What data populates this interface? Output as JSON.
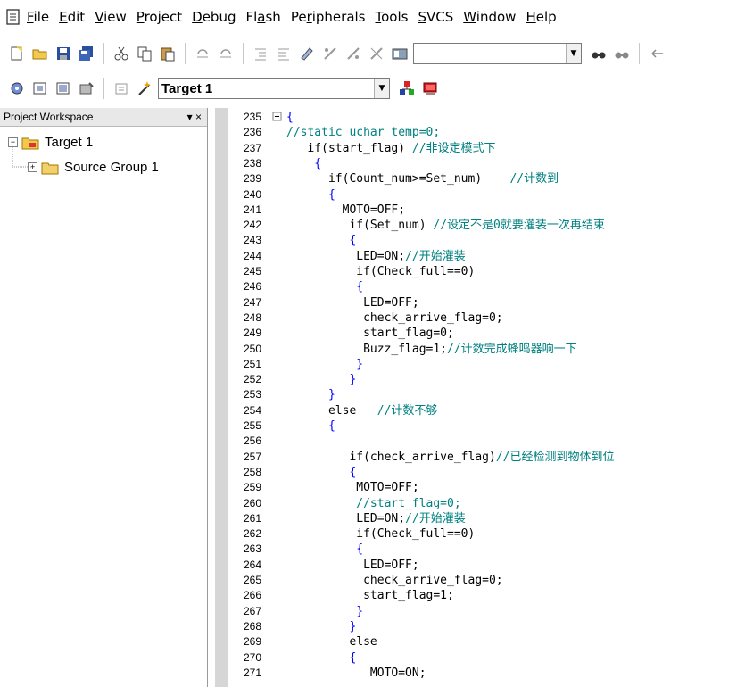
{
  "menu": {
    "items": [
      {
        "u": "F",
        "rest": "ile"
      },
      {
        "u": "E",
        "rest": "dit"
      },
      {
        "u": "V",
        "rest": "iew"
      },
      {
        "u": "P",
        "rest": "roject"
      },
      {
        "u": "D",
        "rest": "ebug"
      },
      {
        "pre": "Fl",
        "u": "a",
        "rest": "sh"
      },
      {
        "pre": "Pe",
        "u": "r",
        "rest": "ipherals"
      },
      {
        "u": "T",
        "rest": "ools"
      },
      {
        "u": "S",
        "rest": "VCS"
      },
      {
        "u": "W",
        "rest": "indow"
      },
      {
        "u": "H",
        "rest": "elp"
      }
    ]
  },
  "toolbar2": {
    "target_combo": "Target 1"
  },
  "workspace": {
    "title": "Project Workspace",
    "controls": "▾ ×",
    "tree": [
      {
        "label": "Target 1",
        "expander": "−"
      },
      {
        "label": "Source Group 1",
        "expander": "+"
      }
    ]
  },
  "editor": {
    "lines": [
      {
        "n": "235",
        "segs": [
          {
            "t": "{",
            "c": "cyan"
          }
        ]
      },
      {
        "n": "236",
        "segs": [
          {
            "t": "//static uchar temp=0;",
            "c": "cmt"
          }
        ]
      },
      {
        "n": "237",
        "segs": [
          {
            "t": "   if(start_flag) ",
            "c": ""
          },
          {
            "t": "//非设定模式下",
            "c": "cmt"
          }
        ]
      },
      {
        "n": "238",
        "segs": [
          {
            "t": "    {",
            "c": "cyan"
          }
        ]
      },
      {
        "n": "239",
        "segs": [
          {
            "t": "      if(Count_num>=Set_num)    ",
            "c": ""
          },
          {
            "t": "//计数到",
            "c": "cmt"
          }
        ]
      },
      {
        "n": "240",
        "segs": [
          {
            "t": "      {",
            "c": "cyan"
          }
        ]
      },
      {
        "n": "241",
        "segs": [
          {
            "t": "        MOTO=OFF;",
            "c": ""
          }
        ]
      },
      {
        "n": "242",
        "segs": [
          {
            "t": "         if(Set_num) ",
            "c": ""
          },
          {
            "t": "//设定不是0就要灌装一次再结束",
            "c": "cmt"
          }
        ]
      },
      {
        "n": "243",
        "segs": [
          {
            "t": "         {",
            "c": "cyan"
          }
        ]
      },
      {
        "n": "244",
        "segs": [
          {
            "t": "          LED=ON;",
            "c": ""
          },
          {
            "t": "//开始灌装",
            "c": "cmt"
          }
        ]
      },
      {
        "n": "245",
        "segs": [
          {
            "t": "          if(Check_full==0)",
            "c": ""
          }
        ]
      },
      {
        "n": "246",
        "segs": [
          {
            "t": "          {",
            "c": "cyan"
          }
        ]
      },
      {
        "n": "247",
        "segs": [
          {
            "t": "           LED=OFF;",
            "c": ""
          }
        ]
      },
      {
        "n": "248",
        "segs": [
          {
            "t": "           check_arrive_flag=0;",
            "c": ""
          }
        ]
      },
      {
        "n": "249",
        "segs": [
          {
            "t": "           start_flag=0;",
            "c": ""
          }
        ]
      },
      {
        "n": "250",
        "segs": [
          {
            "t": "           Buzz_flag=1;",
            "c": ""
          },
          {
            "t": "//计数完成蜂鸣器响一下",
            "c": "cmt"
          }
        ]
      },
      {
        "n": "251",
        "segs": [
          {
            "t": "          }",
            "c": "cyan"
          }
        ]
      },
      {
        "n": "252",
        "segs": [
          {
            "t": "         }",
            "c": "cyan"
          }
        ]
      },
      {
        "n": "253",
        "segs": [
          {
            "t": "      }",
            "c": "cyan"
          }
        ]
      },
      {
        "n": "254",
        "segs": [
          {
            "t": "      else   ",
            "c": ""
          },
          {
            "t": "//计数不够",
            "c": "cmt"
          }
        ]
      },
      {
        "n": "255",
        "segs": [
          {
            "t": "      {",
            "c": "cyan"
          }
        ]
      },
      {
        "n": "256",
        "segs": [
          {
            "t": "",
            "c": ""
          }
        ]
      },
      {
        "n": "257",
        "segs": [
          {
            "t": "         if(check_arrive_flag)",
            "c": ""
          },
          {
            "t": "//已经检测到物体到位",
            "c": "cmt"
          }
        ]
      },
      {
        "n": "258",
        "segs": [
          {
            "t": "         {",
            "c": "cyan"
          }
        ]
      },
      {
        "n": "259",
        "segs": [
          {
            "t": "          MOTO=OFF;",
            "c": ""
          }
        ]
      },
      {
        "n": "260",
        "segs": [
          {
            "t": "          //start_flag=0;",
            "c": "cmt"
          }
        ]
      },
      {
        "n": "261",
        "segs": [
          {
            "t": "          LED=ON;",
            "c": ""
          },
          {
            "t": "//开始灌装",
            "c": "cmt"
          }
        ]
      },
      {
        "n": "262",
        "segs": [
          {
            "t": "          if(Check_full==0)",
            "c": ""
          }
        ]
      },
      {
        "n": "263",
        "segs": [
          {
            "t": "          {",
            "c": "cyan"
          }
        ]
      },
      {
        "n": "264",
        "segs": [
          {
            "t": "           LED=OFF;",
            "c": ""
          }
        ]
      },
      {
        "n": "265",
        "segs": [
          {
            "t": "           check_arrive_flag=0;",
            "c": ""
          }
        ]
      },
      {
        "n": "266",
        "segs": [
          {
            "t": "           start_flag=1;",
            "c": ""
          }
        ]
      },
      {
        "n": "267",
        "segs": [
          {
            "t": "          }",
            "c": "cyan"
          }
        ]
      },
      {
        "n": "268",
        "segs": [
          {
            "t": "         }",
            "c": "cyan"
          }
        ]
      },
      {
        "n": "269",
        "segs": [
          {
            "t": "         else",
            "c": ""
          }
        ]
      },
      {
        "n": "270",
        "segs": [
          {
            "t": "         {",
            "c": "cyan"
          }
        ]
      },
      {
        "n": "271",
        "segs": [
          {
            "t": "            MOTO=ON;",
            "c": ""
          }
        ]
      }
    ]
  },
  "colors": {
    "comment": "#008080",
    "brace": "#0000ff",
    "gutter": "#d6d6d6"
  }
}
